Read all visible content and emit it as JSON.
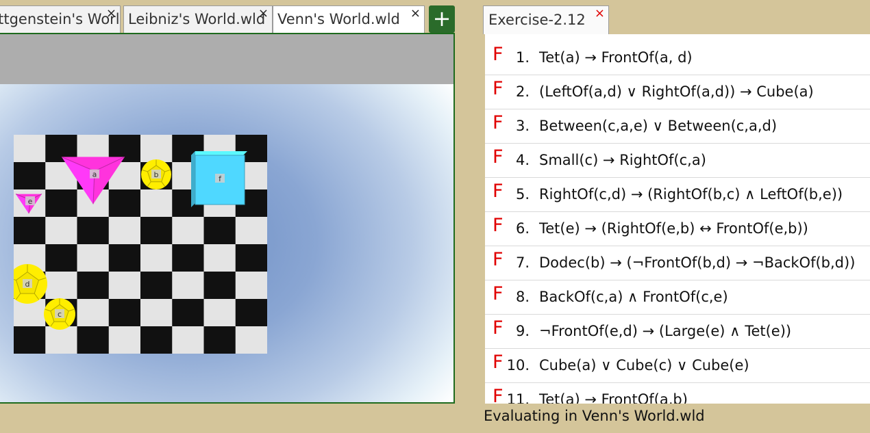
{
  "tabs": [
    {
      "label": "Wittgenstein's World.wld",
      "close": "×"
    },
    {
      "label": "Leibniz's World.wld",
      "close": "×"
    },
    {
      "label": "Venn's World.wld",
      "close": "×"
    }
  ],
  "add_tab_label": "+",
  "world": {
    "objects": [
      {
        "label": "a",
        "shape": "tet",
        "size": "large",
        "color": "#ff33dd"
      },
      {
        "label": "b",
        "shape": "dodec",
        "size": "small",
        "color": "#ffee00"
      },
      {
        "label": "c",
        "shape": "dodec",
        "size": "small",
        "color": "#ffee00"
      },
      {
        "label": "d",
        "shape": "dodec",
        "size": "medium",
        "color": "#ffee00"
      },
      {
        "label": "e",
        "shape": "tet",
        "size": "small",
        "color": "#ff33dd"
      },
      {
        "label": "f",
        "shape": "cube",
        "size": "large",
        "color": "#4fd8ff"
      }
    ]
  },
  "exercise": {
    "title": "Exercise-2.12",
    "close": "×"
  },
  "sentences": [
    {
      "num": "1.",
      "tv": "F",
      "text": "Tet(a)  →  FrontOf(a, d)"
    },
    {
      "num": "2.",
      "tv": "F",
      "text": "(LeftOf(a,d) ∨ RightOf(a,d)) → Cube(a)"
    },
    {
      "num": "3.",
      "tv": "F",
      "text": "Between(c,a,e) ∨ Between(c,a,d)"
    },
    {
      "num": "4.",
      "tv": "F",
      "text": "Small(c) → RightOf(c,a)"
    },
    {
      "num": "5.",
      "tv": "F",
      "text": "RightOf(c,d) → (RightOf(b,c) ∧ LeftOf(b,e))"
    },
    {
      "num": "6.",
      "tv": "F",
      "text": "Tet(e) → (RightOf(e,b) ↔ FrontOf(e,b))"
    },
    {
      "num": "7.",
      "tv": "F",
      "text": "Dodec(b) → (¬FrontOf(b,d) → ¬BackOf(b,d))"
    },
    {
      "num": "8.",
      "tv": "F",
      "text": "BackOf(c,a) ∧ FrontOf(c,e)"
    },
    {
      "num": "9.",
      "tv": "F",
      "text": "¬FrontOf(e,d)  → (Large(e) ∧ Tet(e))"
    },
    {
      "num": "10.",
      "tv": "F",
      "text": "Cube(a) ∨ Cube(c) ∨ Cube(e)"
    },
    {
      "num": "11.",
      "tv": "F",
      "text": "Tet(a) → FrontOf(a,b)"
    }
  ],
  "status": "Evaluating in Venn's World.wld",
  "colors": {
    "truth_false": "#e00000",
    "add_button": "#2a6b2a",
    "frame": "#d4c59a"
  }
}
